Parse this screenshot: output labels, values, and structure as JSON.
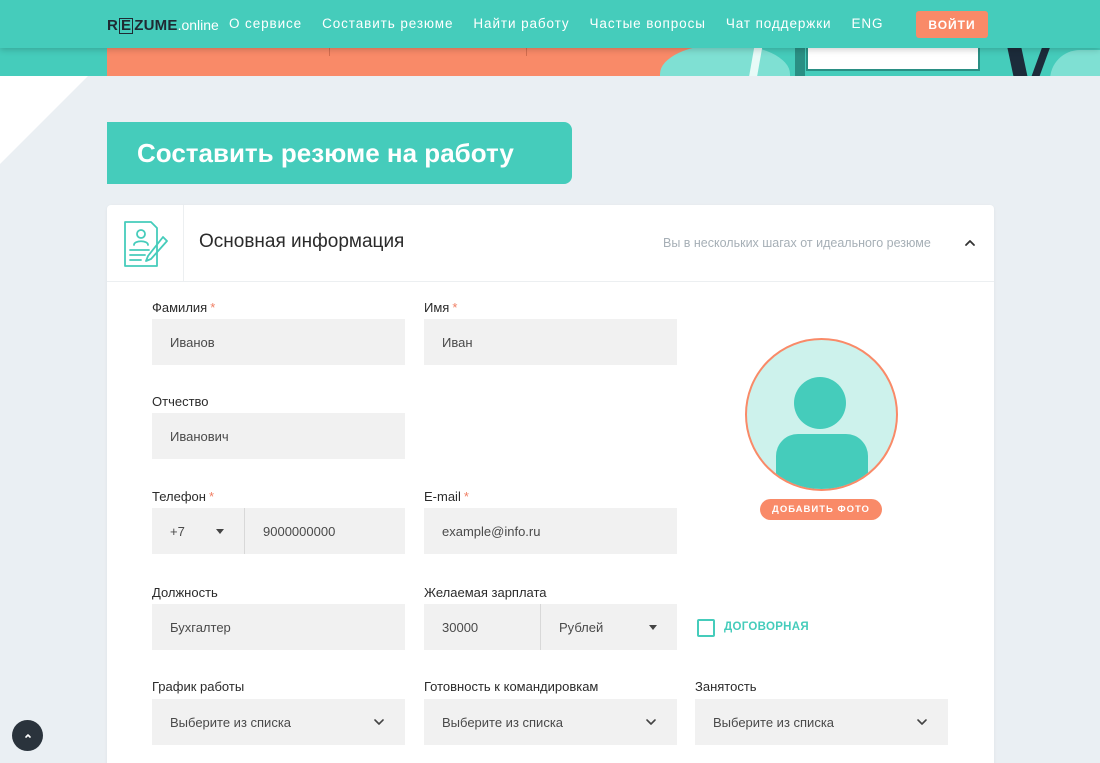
{
  "header": {
    "logo_main_pre": "R",
    "logo_main_box": "E",
    "logo_main_post": "ZUME",
    "logo_tld": ".online",
    "nav": [
      "О сервисе",
      "Составить резюме",
      "Найти работу",
      "Частые вопросы",
      "Чат поддержки",
      "ENG"
    ],
    "login_label": "ВОЙТИ"
  },
  "page": {
    "title": "Составить резюме на работу"
  },
  "section": {
    "title": "Основная информация",
    "hint": "Вы в нескольких шагах от идеального резюме",
    "icon": "resume-document-icon",
    "collapse_icon": "chevron-up-icon"
  },
  "form": {
    "last_name": {
      "label": "Фамилия",
      "required": "*",
      "placeholder": "Иванов"
    },
    "first_name": {
      "label": "Имя",
      "required": "*",
      "placeholder": "Иван"
    },
    "middle_name": {
      "label": "Отчество",
      "placeholder": "Иванович"
    },
    "phone": {
      "label": "Телефон",
      "required": "*",
      "code": "+7",
      "placeholder": "9000000000"
    },
    "email": {
      "label": "E-mail",
      "required": "*",
      "placeholder": "example@info.ru"
    },
    "position": {
      "label": "Должность",
      "placeholder": "Бухгалтер"
    },
    "salary": {
      "label": "Желаемая зарплата",
      "placeholder": "30000",
      "currency": "Рублей"
    },
    "negotiable": {
      "label": "ДОГОВОРНАЯ",
      "checked": false
    },
    "schedule": {
      "label": "График работы",
      "value": "Выберите из списка"
    },
    "travel": {
      "label": "Готовность к командировкам",
      "value": "Выберите из списка"
    },
    "employment": {
      "label": "Занятость",
      "value": "Выберите из списка"
    }
  },
  "photo": {
    "add_label": "ДОБАВИТЬ ФОТО",
    "icon": "user-avatar-icon"
  },
  "colors": {
    "accent": "#45ccbb",
    "orange": "#f98a68",
    "background": "#eaeff3"
  }
}
